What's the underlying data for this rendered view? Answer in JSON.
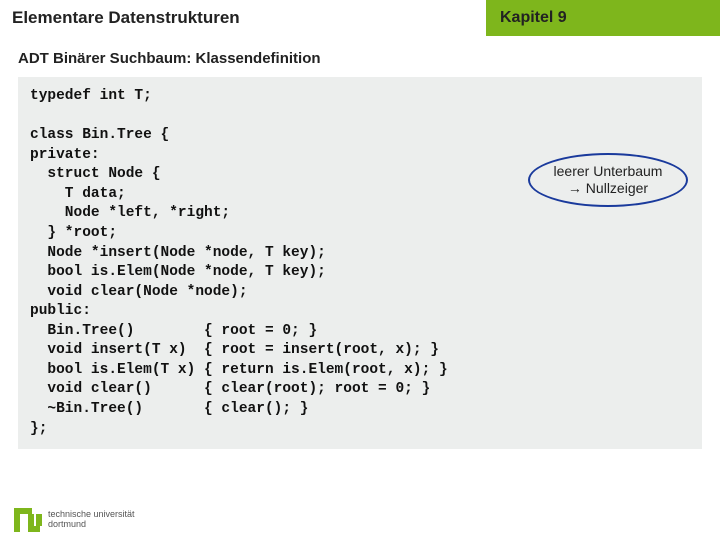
{
  "header": {
    "left_title": "Elementare Datenstrukturen",
    "right_title": "Kapitel 9"
  },
  "subtitle": "ADT Binärer Suchbaum: Klassendefinition",
  "code": "typedef int T;\n\nclass Bin.Tree {\nprivate:\n  struct Node {\n    T data;\n    Node *left, *right;\n  } *root;\n  Node *insert(Node *node, T key);\n  bool is.Elem(Node *node, T key);\n  void clear(Node *node);\npublic:\n  Bin.Tree()        { root = 0; }\n  void insert(T x)  { root = insert(root, x); }\n  bool is.Elem(T x) { return is.Elem(root, x); }\n  void clear()      { clear(root); root = 0; }\n  ~Bin.Tree()       { clear(); }\n};",
  "annotation": {
    "line1": "leerer Unterbaum",
    "line2": "→ Nullzeiger"
  },
  "footer": {
    "line1": "technische universität",
    "line2": "dortmund"
  }
}
